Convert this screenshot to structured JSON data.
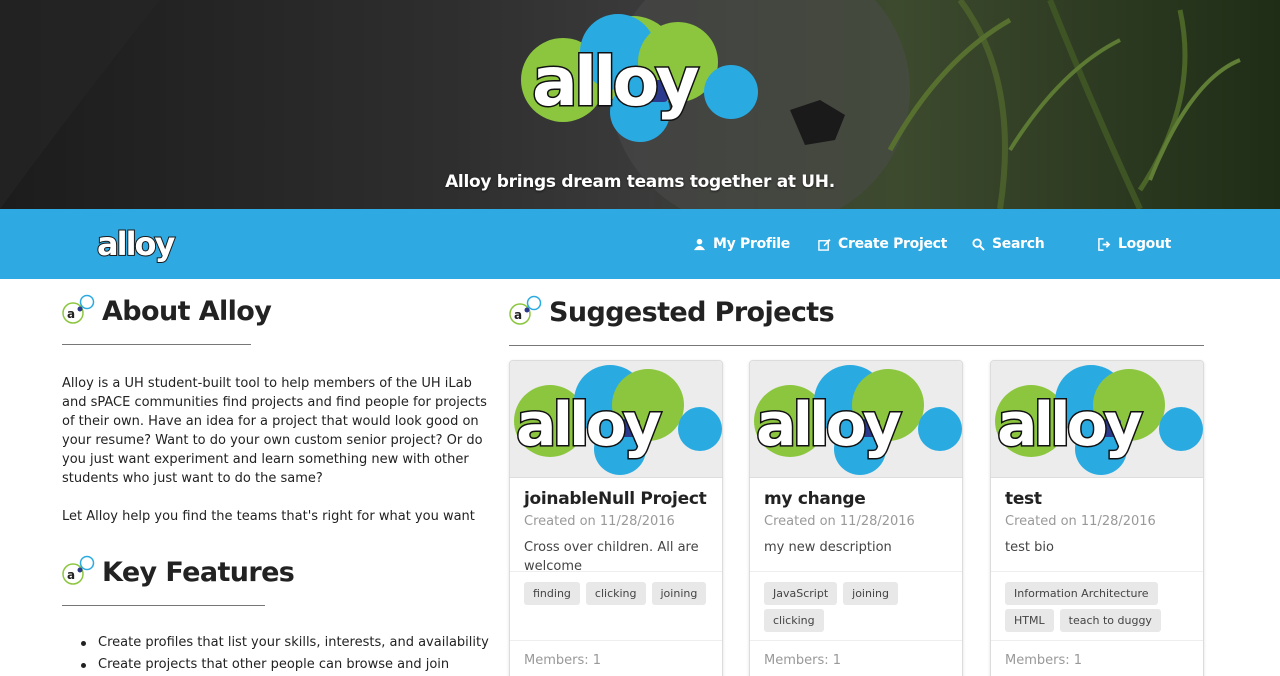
{
  "hero": {
    "logo_text": "alloy",
    "tagline": "Alloy brings dream teams together at UH."
  },
  "navbar": {
    "brand": "alloy",
    "items": [
      {
        "label": "My Profile",
        "icon": "user-icon"
      },
      {
        "label": "Create Project",
        "icon": "edit-icon"
      },
      {
        "label": "Search",
        "icon": "search-icon"
      },
      {
        "label": "Logout",
        "icon": "logout-icon"
      }
    ]
  },
  "about": {
    "title": "About Alloy",
    "paragraphs": [
      "Alloy is a UH student-built tool to help members of the UH iLab and sPACE communities find projects and find people for projects of their own. Have an idea for a project that would look good on your resume? Want to do your own custom senior project? Or do you just want experiment and learn something new with other students who just want to do the same?",
      "Let Alloy help you find the teams that's right for what you want"
    ]
  },
  "key_features": {
    "title": "Key Features",
    "items": [
      "Create profiles that list your skills, interests, and availability",
      "Create projects that other people can browse and join"
    ]
  },
  "suggested": {
    "title": "Suggested Projects",
    "projects": [
      {
        "title": "joinableNull Project",
        "created": "Created on 11/28/2016",
        "description": "Cross over children. All are welcome",
        "tags": [
          "finding",
          "clicking",
          "joining"
        ],
        "members": "Members: 1"
      },
      {
        "title": "my change",
        "created": "Created on 11/28/2016",
        "description": "my new description",
        "tags": [
          "JavaScript",
          "joining",
          "clicking"
        ],
        "members": "Members: 1"
      },
      {
        "title": "test",
        "created": "Created on 11/28/2016",
        "description": "test bio",
        "tags": [
          "Information Architecture",
          "HTML",
          "teach to duggy"
        ],
        "members": "Members: 1"
      }
    ]
  },
  "colors": {
    "navbar": "#2ea9e1",
    "logo_green": "#8cc63f",
    "logo_blue": "#29abe2",
    "logo_navy": "#2b3a8c"
  }
}
